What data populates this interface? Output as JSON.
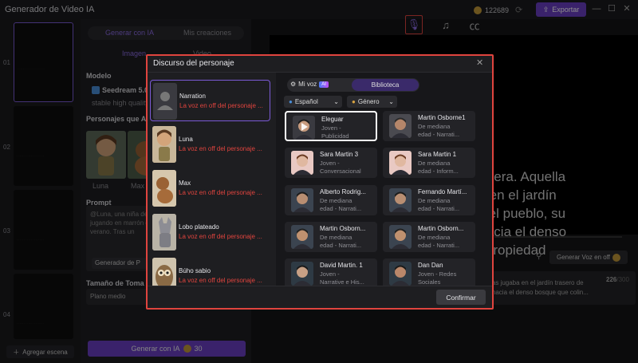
{
  "window": {
    "title": "Generador de Video IA",
    "credits": "122689",
    "export_label": "Exportar"
  },
  "scenes": {
    "numbers": [
      "01",
      "02",
      "03",
      "04"
    ],
    "add_label": "Agregar escena"
  },
  "side_panel": {
    "tabs": [
      "Generar con IA",
      "Mis creaciones"
    ],
    "subtabs": [
      "Imagen",
      "Video"
    ],
    "model_label": "Modelo",
    "model_name": "Seedream 5.0",
    "model_desc": "stable high quality",
    "characters_label": "Personajes que Apa",
    "characters": [
      "Luna",
      "Max"
    ],
    "prompt_label": "Prompt",
    "prompt_text": "@Luna, una niña de verano, jugando en verano, jugando en marrón de tamaño ladrando hacia el verano. Tras un",
    "prompt_generator": "Generador de P",
    "shot_size_label": "Tamaño de Toma",
    "shot_size_value": "Plano medio",
    "generate_label": "Generar con IA",
    "generate_cost": "30"
  },
  "main": {
    "preview_text": "nturera. Aquella\nba en el jardín\ns del pueblo, su\nr hacia el denso\n... propiedad",
    "generate_voice_label": "Generar Voz en off",
    "speech_text": "tras jugaba en el jardín trasero de\nr hacia el denso bosque que colin...",
    "speech_count": "226",
    "speech_max": "/300"
  },
  "modal": {
    "title": "Discurso del personaje",
    "characters": [
      {
        "name": "Narration",
        "desc": "La voz en off del personaje ..."
      },
      {
        "name": "Luna",
        "desc": "La voz en off del personaje ..."
      },
      {
        "name": "Max",
        "desc": "La voz en off del personaje ..."
      },
      {
        "name": "Lobo plateado",
        "desc": "La voz en off del personaje ..."
      },
      {
        "name": "Búho sabio",
        "desc": "La voz en off del personaje ..."
      }
    ],
    "tab_my_voice": "Mi voz",
    "ai_badge": "AI",
    "tab_library": "Biblioteca",
    "filter_language": "Español",
    "filter_gender": "Género",
    "voices": [
      {
        "name": "Eleguar",
        "line1": "Joven -",
        "line2": "Publicidad"
      },
      {
        "name": "Martin Osborne1",
        "line1": "De mediana",
        "line2": "edad - Narrati..."
      },
      {
        "name": "Sara Martin 3",
        "line1": "Joven -",
        "line2": "Conversacional"
      },
      {
        "name": "Sara Martin 1",
        "line1": "De mediana",
        "line2": "edad - Inform..."
      },
      {
        "name": "Alberto Rodrig...",
        "line1": "De mediana",
        "line2": "edad - Narrati..."
      },
      {
        "name": "Fernando Martí...",
        "line1": "De mediana",
        "line2": "edad - Narrati..."
      },
      {
        "name": "Martin Osborn...",
        "line1": "De mediana",
        "line2": "edad - Narrati..."
      },
      {
        "name": "Martin Osborn...",
        "line1": "De mediana",
        "line2": "edad - Narrati..."
      },
      {
        "name": "David Martin. 1",
        "line1": "Joven -",
        "line2": "Narrative e His..."
      },
      {
        "name": "Dan Dan",
        "line1": "Joven - Redes",
        "line2": "Sociales"
      }
    ],
    "confirm_label": "Confirmar"
  },
  "colors": {
    "accent": "#6b3fc4",
    "highlight": "#e0443e",
    "selection": "#7b5ad6"
  }
}
